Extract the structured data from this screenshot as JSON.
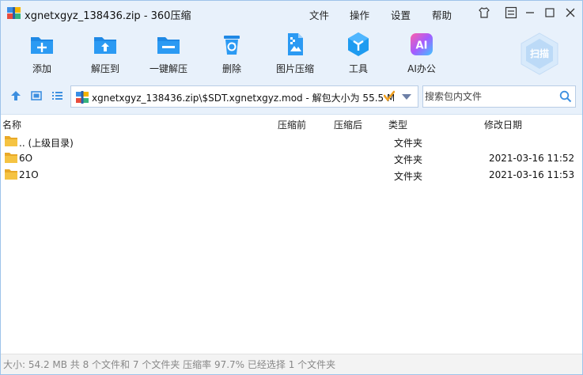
{
  "window": {
    "title": "xgnetxgyz_138436.zip - 360压缩"
  },
  "menu": [
    {
      "label": "文件"
    },
    {
      "label": "操作"
    },
    {
      "label": "设置"
    },
    {
      "label": "帮助"
    }
  ],
  "toolbar": {
    "add_label": "添加",
    "extract_to_label": "解压到",
    "one_click_label": "一键解压",
    "delete_label": "删除",
    "image_compress_label": "图片压缩",
    "tools_label": "工具",
    "ai_label": "AI办公",
    "ai_icon_text": "AI",
    "scan_label": "扫描"
  },
  "address": {
    "path": "xgnetxgyz_138436.zip\\$SDT.xgnetxgyz.mod - 解包大小为 55.5 MB",
    "search_placeholder": "搜索包内文件"
  },
  "columns": {
    "name": "名称",
    "before": "压缩前",
    "after": "压缩后",
    "type": "类型",
    "modified": "修改日期"
  },
  "files": [
    {
      "name": ".. (上级目录)",
      "type": "文件夹",
      "date": ""
    },
    {
      "name": "6O",
      "type": "文件夹",
      "date": "2021-03-16 11:52"
    },
    {
      "name": "21O",
      "type": "文件夹",
      "date": "2021-03-16 11:53"
    }
  ],
  "status": {
    "text": "大小: 54.2 MB 共 8 个文件和 7 个文件夹 压缩率 97.7% 已经选择 1 个文件夹"
  },
  "colors": {
    "chrome_bg": "#e8f1fb",
    "accent": "#1e88e5",
    "folder": "#f5c342"
  }
}
